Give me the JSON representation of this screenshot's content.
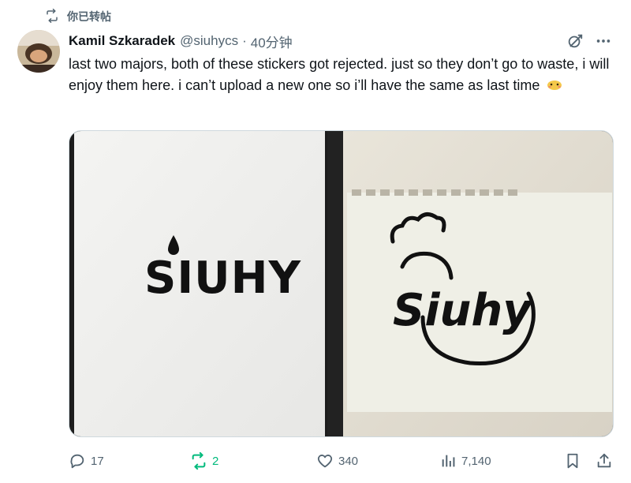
{
  "repost_banner": {
    "text": "你已转帖"
  },
  "author": {
    "display_name": "Kamil Szkaradek",
    "handle": "@siuhycs",
    "separator": "·",
    "time": "40分钟"
  },
  "tweet": {
    "text": "last two majors, both of these stickers got rejected. just so they don’t go to waste, i will enjoy them here. i can’t upload a new one so i’ll have the same as last time"
  },
  "media": {
    "left_sticker_text": "SIUHY",
    "right_sticker_text": "Siuhy"
  },
  "actions": {
    "replies": "17",
    "reposts": "2",
    "likes": "340",
    "views": "7,140"
  },
  "colors": {
    "text_primary": "#0f1419",
    "text_secondary": "#536471",
    "repost_active": "#00ba7c"
  }
}
